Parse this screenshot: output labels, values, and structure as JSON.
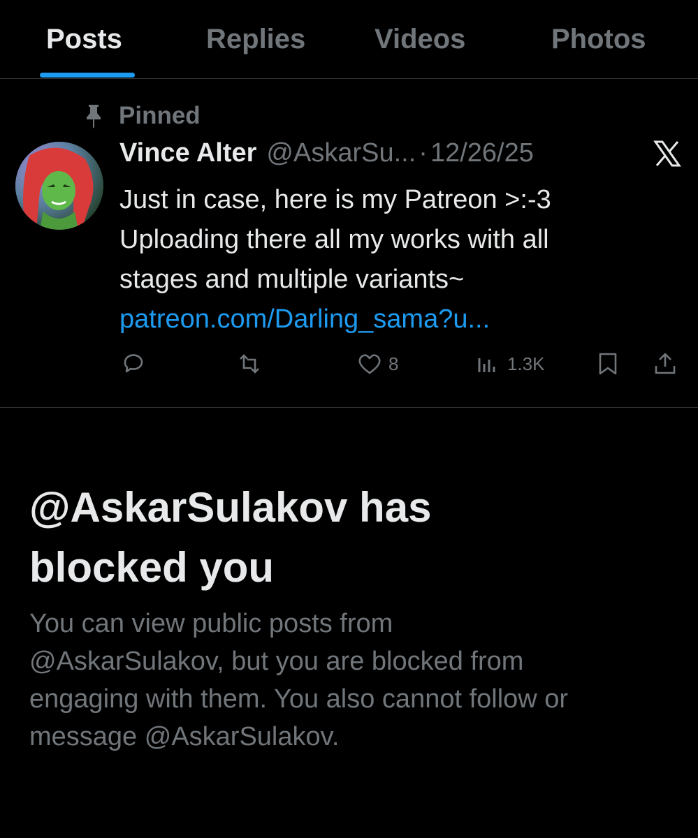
{
  "tabs": [
    {
      "label": "Posts",
      "active": true
    },
    {
      "label": "Replies",
      "active": false
    },
    {
      "label": "Videos",
      "active": false
    },
    {
      "label": "Photos",
      "active": false
    }
  ],
  "pinned": {
    "label": "Pinned",
    "icon": "pin-icon"
  },
  "post": {
    "author_name": "Vince Alter",
    "author_handle": "@AskarSu...",
    "separator": "·",
    "date": "12/26/25",
    "body_lines": [
      "Just in case, here is my Patreon >:-3",
      "Uploading there all my works with all",
      "stages and multiple variants~"
    ],
    "link": "patreon.com/Darling_sama?u...",
    "actions": {
      "reply": {
        "icon": "reply-icon",
        "count": ""
      },
      "repost": {
        "icon": "repost-icon",
        "count": ""
      },
      "like": {
        "icon": "heart-icon",
        "count": "8"
      },
      "views": {
        "icon": "views-icon",
        "count": "1.3K"
      },
      "bookmark": {
        "icon": "bookmark-icon"
      },
      "share": {
        "icon": "share-icon"
      }
    }
  },
  "blocked": {
    "title_line1": "@AskarSulakov has",
    "title_line2": "blocked you",
    "description_lines": [
      "You can view public posts from",
      "@AskarSulakov, but you are blocked from",
      "engaging with them. You also cannot follow or",
      "message @AskarSulakov."
    ]
  },
  "colors": {
    "background": "#000000",
    "text_primary": "#e7e9ea",
    "text_secondary": "#71767b",
    "accent": "#1d9bf0",
    "divider": "#2f3336"
  }
}
